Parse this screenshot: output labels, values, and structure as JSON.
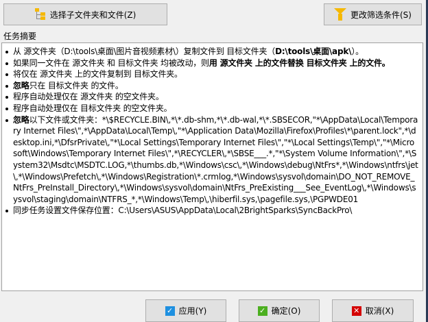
{
  "toolbar": {
    "select_label": "选择子文件夹和文件(Z)",
    "filter_label": "更改筛选条件(S)"
  },
  "summary_label": "任务摘要",
  "items": [
    [
      {
        "t": "从 源文件夹（D:\\tools\\桌面\\图片音视频素材\\）复制文件到 目标文件夹（"
      },
      {
        "t": "D:\\tools\\桌面\\apk\\",
        "b": true
      },
      {
        "t": "）。"
      }
    ],
    [
      {
        "t": "如果同一文件在 源文件夹 和 目标文件夹 均被改动，则"
      },
      {
        "t": "用 源文件夹 上的文件替换 目标文件夹 上的文件。",
        "b": true
      }
    ],
    [
      {
        "t": "将仅在 源文件夹 上的文件复制到 目标文件夹。"
      }
    ],
    [
      {
        "t": "忽略",
        "b": true
      },
      {
        "t": "只在 目标文件夹 的文件。"
      }
    ],
    [
      {
        "t": "程序自动处理仅在 源文件夹 的空文件夹。"
      }
    ],
    [
      {
        "t": "程序自动处理仅在 目标文件夹 的空文件夹。"
      }
    ],
    [
      {
        "t": "忽略",
        "b": true
      },
      {
        "t": "以下文件或文件夹：*\\$RECYCLE.BIN\\,*\\*.db-shm,*\\*.db-wal,*\\*.SBSECOR,\"*\\AppData\\Local\\Temporary Internet Files\\\",*\\AppData\\Local\\Temp\\,\"*\\Application Data\\Mozilla\\Firefox\\Profiles\\*\\parent.lock\",*\\desktop.ini,*\\DfsrPrivate\\,\"*\\Local Settings\\Temporary Internet Files\\\",\"*\\Local Settings\\Temp\\\",\"*\\Microsoft\\Windows\\Temporary Internet Files\\\",*\\RECYCLER\\,*\\SBSE___.*,\"*\\System Volume Information\\\",*\\System32\\Msdtc\\MSDTC.LOG,*\\thumbs.db,*\\Windows\\csc\\,*\\Windows\\debug\\NtFrs*,*\\Windows\\ntfrs\\jet\\,*\\Windows\\Prefetch\\,*\\Windows\\Registration\\*.crmlog,*\\Windows\\sysvol\\domain\\DO_NOT_REMOVE_NtFrs_PreInstall_Directory\\,*\\Windows\\sysvol\\domain\\NtFrs_PreExisting___See_EventLog\\,*\\Windows\\sysvol\\staging\\domain\\NTFRS_*,*\\Windows\\Temp\\,\\hiberfil.sys,\\pagefile.sys,\\PGPWDE01"
      }
    ],
    [
      {
        "t": "同步任务设置文件保存位置：C:\\Users\\ASUS\\AppData\\Local\\2BrightSparks\\SyncBackPro\\"
      }
    ]
  ],
  "footer": {
    "apply_label": "应用(Y)",
    "ok_label": "确定(O)",
    "cancel_label": "取消(X)"
  },
  "colors": {
    "folder": "#f5b800",
    "filter": "#f5b800",
    "apply": "#1e90e0",
    "ok": "#4caf20",
    "cancel": "#d40000"
  }
}
